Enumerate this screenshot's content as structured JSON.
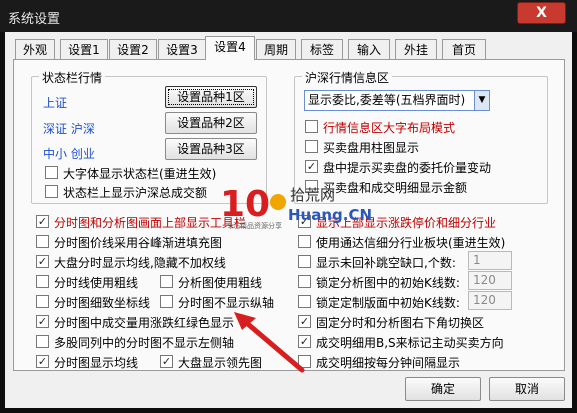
{
  "window": {
    "title": "系统设置",
    "close": "X"
  },
  "tabs": [
    "外观",
    "设置1",
    "设置2",
    "设置3",
    "设置4",
    "周期",
    "标签",
    "输入",
    "外挂",
    "首页"
  ],
  "status_group": {
    "title": "状态栏行情",
    "rows": [
      {
        "label": "上证",
        "button": "设置品种1区"
      },
      {
        "label": "深证 沪深",
        "button": "设置品种2区"
      },
      {
        "label": "中小 创业",
        "button": "设置品种3区"
      }
    ],
    "checks": [
      {
        "text": "大字体显示状态栏(重进生效)",
        "checked": false
      },
      {
        "text": "状态栏上显示沪深总成交额",
        "checked": false
      }
    ]
  },
  "hs_group": {
    "title": "沪深行情信息区",
    "select_value": "显示委比,委差等(五档界面时)",
    "checks": [
      {
        "text": "行情信息区大字布局模式",
        "checked": false,
        "red": true
      },
      {
        "text": "买卖盘用柱图显示",
        "checked": false
      },
      {
        "text": "盘中提示买卖盘的委托价量变动",
        "checked": true
      },
      {
        "text": "买卖盘和成交明细显示金额",
        "checked": false
      }
    ]
  },
  "left_checks": [
    {
      "text": "分时图和分析图画面上部显示工具栏",
      "checked": true,
      "red": true
    },
    {
      "text": "分时图价线采用谷峰渐进填充图",
      "checked": false
    },
    {
      "text": "大盘分时显示均线,隐藏不加权线",
      "checked": true
    },
    {
      "text": "分时线使用粗线",
      "checked": false
    },
    {
      "text": "分时图细致坐标线",
      "checked": false
    },
    {
      "text": "分时图中成交量用涨跌红绿色显示",
      "checked": true
    },
    {
      "text": "多股同列中的分时图不显示左侧轴",
      "checked": false
    },
    {
      "text": "分时图显示均线",
      "checked": true
    }
  ],
  "mid_checks": [
    {
      "text": "分析图使用粗线",
      "checked": false
    },
    {
      "text": "分时图不显示纵轴",
      "checked": false
    },
    {
      "text": "大盘显示领先图",
      "checked": true
    }
  ],
  "right_checks": [
    {
      "text": "显示上部显示涨跌停价和细分行业",
      "checked": true,
      "red": true
    },
    {
      "text": "使用通达信细分行业板块(重进生效)",
      "checked": false
    },
    {
      "text": "显示未回补跳空缺口,个数:",
      "checked": false,
      "value": "1"
    },
    {
      "text": "锁定分析图中的初始K线数:",
      "checked": false,
      "value": "120"
    },
    {
      "text": "锁定定制版面中初始K线数:",
      "checked": false,
      "value": "120"
    },
    {
      "text": "固定分时和分析图右下角切换区",
      "checked": true
    },
    {
      "text": "成交明细用B,S来标记主动买卖方向",
      "checked": true
    },
    {
      "text": "成交明细按每分钟间隔显示",
      "checked": false
    }
  ],
  "buttons": {
    "ok": "确定",
    "cancel": "取消"
  },
  "watermark": {
    "logo": "10",
    "brand_cn": "拾荒网",
    "brand_en": "Huang.CN",
    "tagline": "专注精品资源分享"
  },
  "colors": {
    "red": "#c00000",
    "blue": "#1c4fd0",
    "arrow": "#d81e1e"
  }
}
